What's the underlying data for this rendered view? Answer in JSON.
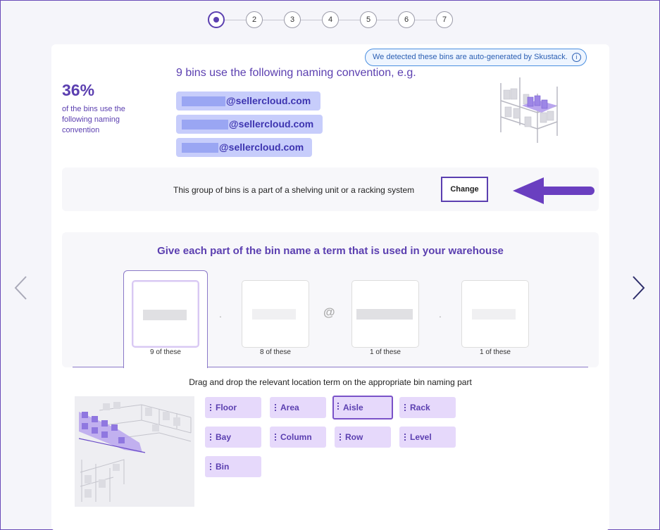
{
  "stepper": {
    "steps": [
      "1",
      "2",
      "3",
      "4",
      "5",
      "6",
      "7"
    ],
    "active_index": 0
  },
  "notice": {
    "text": "We detected these bins are auto-generated by Skustack.",
    "icon": "info-icon"
  },
  "summary": {
    "percent": "36%",
    "description": "of the bins use the following naming convention"
  },
  "convention": {
    "title": "9 bins use the following naming convention, e.g.",
    "examples": [
      "@sellercloud.com",
      "@sellercloud.com",
      "@sellercloud.com"
    ]
  },
  "group": {
    "text": "This group of bins is a part of a shelving unit or a racking system",
    "change_label": "Change"
  },
  "terms": {
    "title": "Give each part of the bin name a term that is used in your warehouse",
    "separators": [
      ".",
      "@",
      "."
    ],
    "slots": [
      {
        "count": "9 of these"
      },
      {
        "count": "8 of these"
      },
      {
        "count": "1 of these"
      },
      {
        "count": "1 of these"
      }
    ]
  },
  "drag": {
    "title": "Drag and drop the relevant location term on the appropriate bin naming part",
    "chips": [
      "Floor",
      "Area",
      "Aisle",
      "Rack",
      "Bay",
      "Column",
      "Row",
      "Level",
      "Bin"
    ],
    "selected_chip": "Aisle"
  },
  "colors": {
    "accent": "#5b3fb0",
    "chip_bg": "#e6d9fb",
    "email_bg": "#c7cdfb",
    "notice_border": "#4a8fe0"
  }
}
